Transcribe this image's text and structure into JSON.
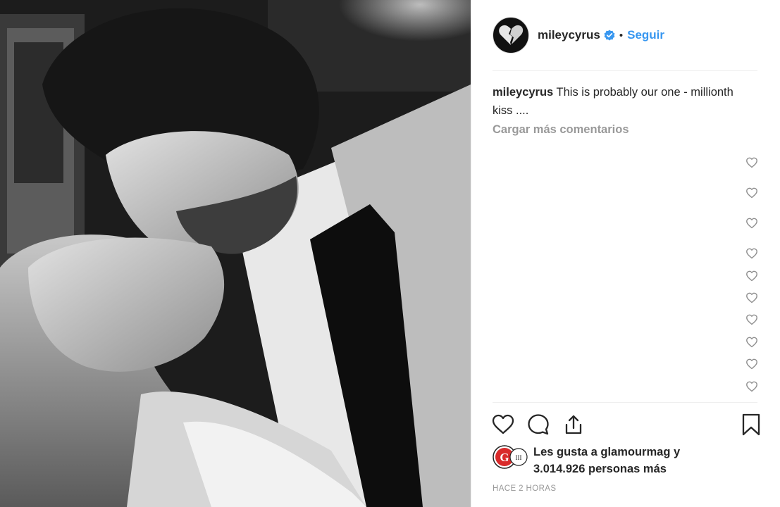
{
  "header": {
    "username": "mileycyrus",
    "separator": "•",
    "follow_label": "Seguir"
  },
  "caption": {
    "username": "mileycyrus",
    "text": "This is probably our one - millionth kiss ...."
  },
  "comments": {
    "load_more_label": "Cargar más comentarios",
    "like_icons": [
      "heart-icon",
      "heart-icon",
      "heart-icon",
      "heart-icon",
      "heart-icon",
      "heart-icon",
      "heart-icon",
      "heart-icon",
      "heart-icon",
      "heart-icon"
    ]
  },
  "actions": {
    "icons": [
      "heart-icon",
      "comment-icon",
      "share-icon",
      "bookmark-icon"
    ]
  },
  "likes": {
    "line1_prefix": "Les gusta a",
    "liker": "glamourmag",
    "line1_suffix": "y",
    "line2": "3.014.926 personas más"
  },
  "timestamp": "HACE 2 HORAS",
  "colors": {
    "link": "#3897f0",
    "text": "#262626",
    "muted": "#999999",
    "divider": "#efefef"
  }
}
